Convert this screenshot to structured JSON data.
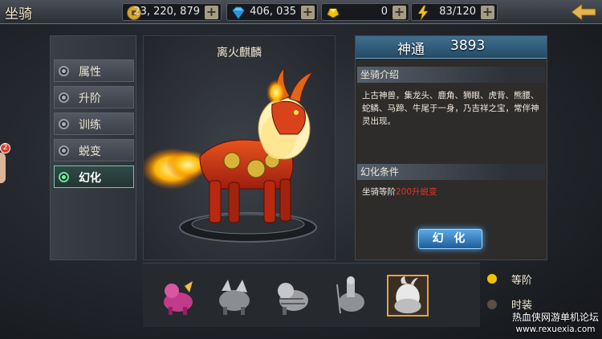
{
  "header": {
    "title": "坐骑"
  },
  "resources": [
    {
      "name": "copper",
      "icon": "coin-icon",
      "value": "23, 220, 879"
    },
    {
      "name": "diamond",
      "icon": "diamond-icon",
      "value": "406, 035"
    },
    {
      "name": "gold",
      "icon": "gold-ingot-icon",
      "value": "0"
    },
    {
      "name": "energy",
      "icon": "lightning-icon",
      "value": "83/120"
    }
  ],
  "menu": {
    "items": [
      {
        "label": "属性",
        "active": false
      },
      {
        "label": "升阶",
        "active": false
      },
      {
        "label": "训练",
        "active": false
      },
      {
        "label": "蜕变",
        "active": false
      },
      {
        "label": "幻化",
        "active": true
      }
    ]
  },
  "notification": {
    "count": "2"
  },
  "stage": {
    "mount_name": "离火麒麟"
  },
  "panel": {
    "power_label": "神通",
    "power_value": "3893",
    "intro_title": "坐骑介绍",
    "intro_text": "上古神兽，集龙头、鹿角、狮眼、虎背、熊腰、蛇鳞、马蹄、牛尾于一身，乃吉祥之宝，常伴神灵出现。",
    "condition_title": "幻化条件",
    "condition_prefix": "坐骑等阶",
    "condition_highlight": "200升蜕变",
    "transform_button": "幻 化"
  },
  "bottom": {
    "filter_level": "等阶",
    "filter_fashion": "时装"
  },
  "watermark": {
    "line1": "热血侠网游单机论坛",
    "line2": "www.rexuexia.com"
  },
  "colors": {
    "accent_gold": "#f2c200",
    "highlight_red": "#e0342a",
    "active_green": "#6cff9c"
  }
}
